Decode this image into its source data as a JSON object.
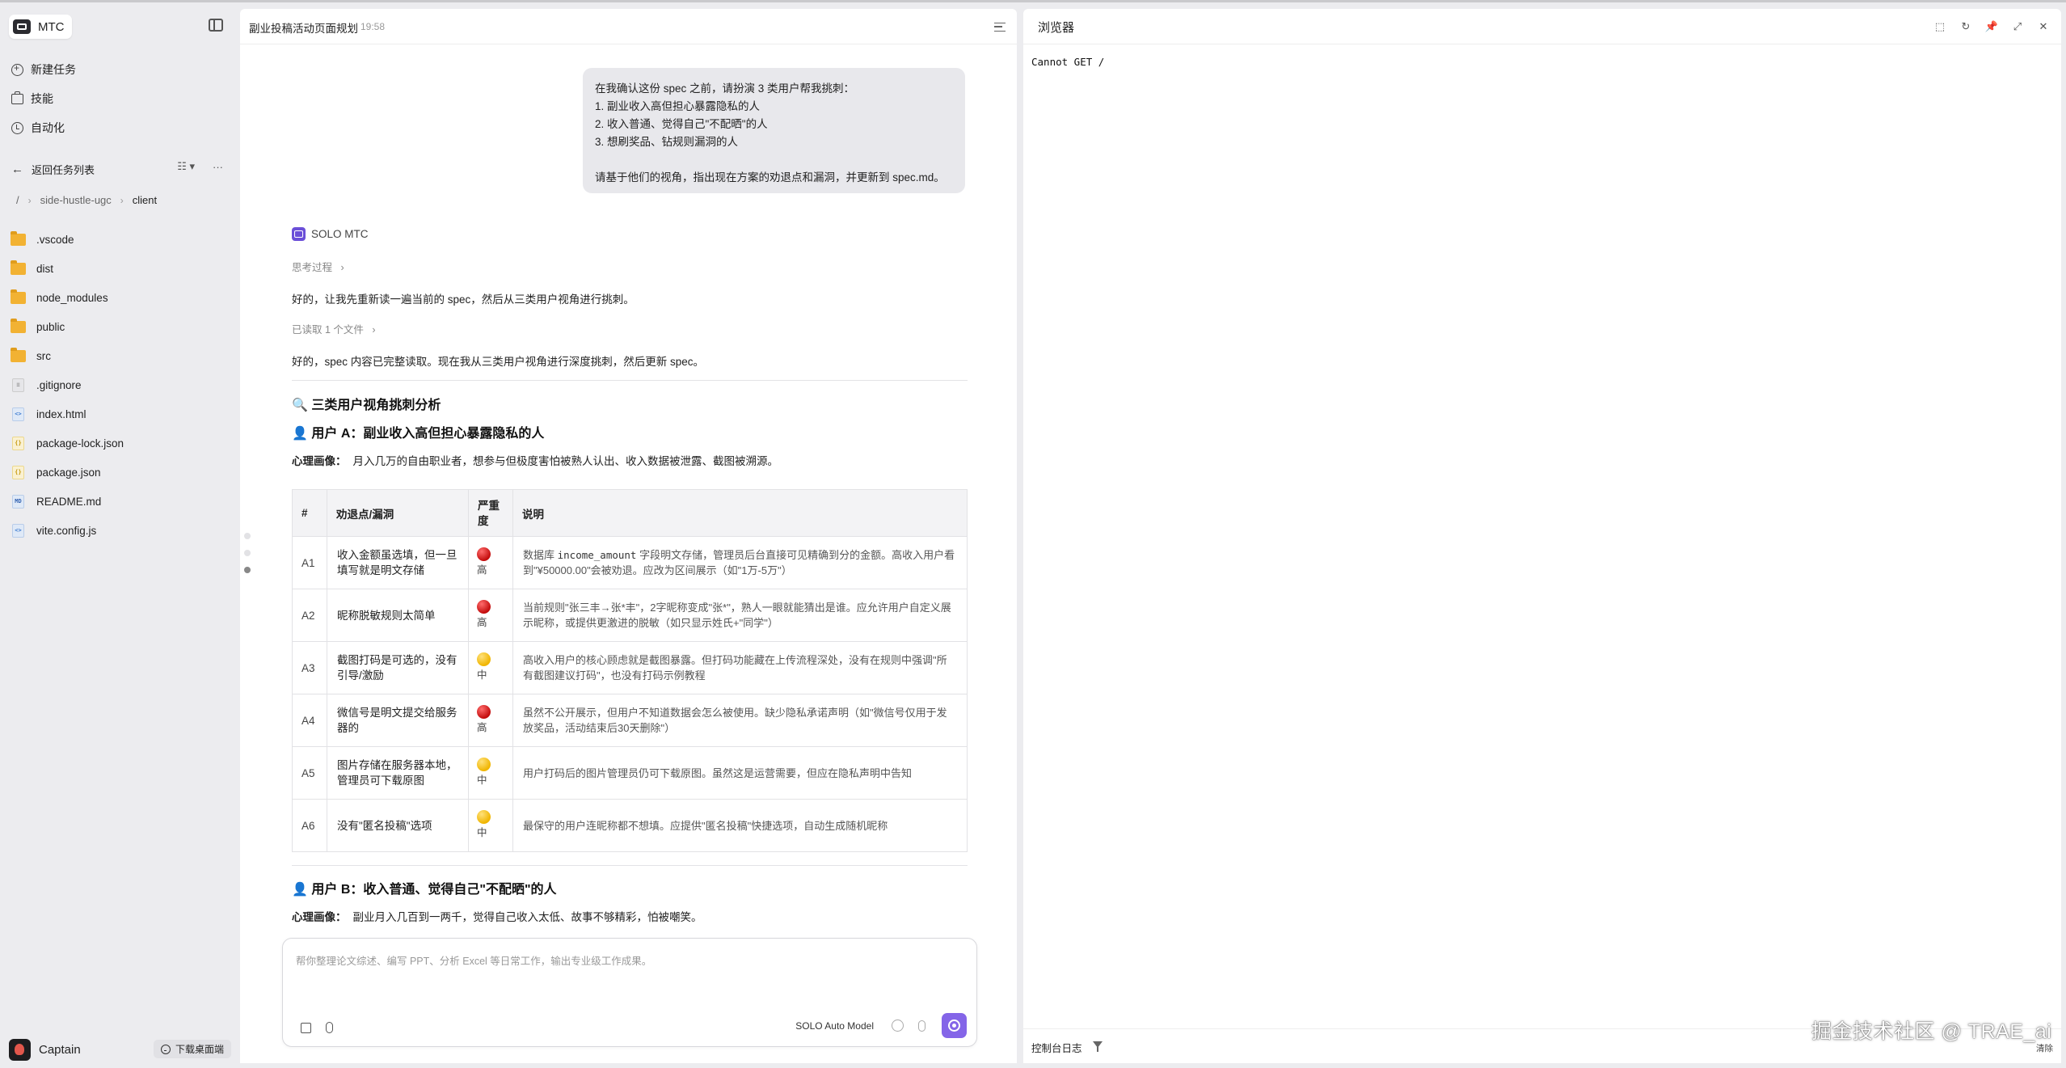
{
  "sidebar": {
    "brand": "MTC",
    "nav": [
      {
        "label": "新建任务",
        "icon": "new-task-icon"
      },
      {
        "label": "技能",
        "icon": "skills-icon"
      },
      {
        "label": "自动化",
        "icon": "automation-icon"
      }
    ],
    "back_label": "返回任务列表",
    "breadcrumb": [
      "/",
      "side-hustle-ugc",
      "client"
    ],
    "files": [
      {
        "name": ".vscode",
        "type": "folder"
      },
      {
        "name": "dist",
        "type": "folder"
      },
      {
        "name": "node_modules",
        "type": "folder"
      },
      {
        "name": "public",
        "type": "folder"
      },
      {
        "name": "src",
        "type": "folder"
      },
      {
        "name": ".gitignore",
        "type": "git"
      },
      {
        "name": "index.html",
        "type": "html"
      },
      {
        "name": "package-lock.json",
        "type": "json"
      },
      {
        "name": "package.json",
        "type": "json"
      },
      {
        "name": "README.md",
        "type": "md"
      },
      {
        "name": "vite.config.js",
        "type": "js"
      }
    ],
    "user_name": "Captain",
    "download_label": "下载桌面端"
  },
  "chat": {
    "title": "副业投稿活动页面规划",
    "time": "19:58",
    "user_message": [
      "在我确认这份 spec 之前，请扮演 3 类用户帮我挑刺：",
      "1. 副业收入高但担心暴露隐私的人",
      "2. 收入普通、觉得自己\"不配晒\"的人",
      "3. 想刷奖品、钻规则漏洞的人",
      "",
      "请基于他们的视角，指出现在方案的劝退点和漏洞，并更新到 spec.md。"
    ],
    "agent_name": "SOLO MTC",
    "thinking_label": "思考过程",
    "reply_1": "好的，让我先重新读一遍当前的 spec，然后从三类用户视角进行挑刺。",
    "files_read_label": "已读取 1 个文件",
    "reply_2": "好的，spec 内容已完整读取。现在我从三类用户视角进行深度挑刺，然后更新 spec。",
    "section_title": "🔍 三类用户视角挑刺分析",
    "user_a_title": "👤 用户 A：副业收入高但担心暴露隐私的人",
    "user_a_profile_label": "心理画像：",
    "user_a_profile": "月入几万的自由职业者，想参与但极度害怕被熟人认出、收入数据被泄露、截图被溯源。",
    "table": {
      "headers": [
        "#",
        "劝退点/漏洞",
        "严重度",
        "说明"
      ],
      "rows": [
        {
          "id": "A1",
          "point": "收入金额虽选填，但一旦填写就是明文存储",
          "severity": "高",
          "level": "red",
          "desc_pre": "数据库 ",
          "desc_code": "income_amount",
          "desc_post": " 字段明文存储，管理员后台直接可见精确到分的金额。高收入用户看到\"¥50000.00\"会被劝退。应改为区间展示（如\"1万-5万\"）"
        },
        {
          "id": "A2",
          "point": "昵称脱敏规则太简单",
          "severity": "高",
          "level": "red",
          "desc_pre": "当前规则\"张三丰→张*丰\"，2字昵称变成\"张*\"，熟人一眼就能猜出是谁。应允许用户自定义展示昵称，或提供更激进的脱敏（如只显示姓氏+\"同学\"）",
          "desc_code": "",
          "desc_post": ""
        },
        {
          "id": "A3",
          "point": "截图打码是可选的，没有引导/激励",
          "severity": "中",
          "level": "yellow",
          "desc_pre": "高收入用户的核心顾虑就是截图暴露。但打码功能藏在上传流程深处，没有在规则中强调\"所有截图建议打码\"，也没有打码示例教程",
          "desc_code": "",
          "desc_post": ""
        },
        {
          "id": "A4",
          "point": "微信号是明文提交给服务器的",
          "severity": "高",
          "level": "red",
          "desc_pre": "虽然不公开展示，但用户不知道数据会怎么被使用。缺少隐私承诺声明（如\"微信号仅用于发放奖品，活动结束后30天删除\"）",
          "desc_code": "",
          "desc_post": ""
        },
        {
          "id": "A5",
          "point": "图片存储在服务器本地，管理员可下载原图",
          "severity": "中",
          "level": "yellow",
          "desc_pre": "用户打码后的图片管理员仍可下载原图。虽然这是运营需要，但应在隐私声明中告知",
          "desc_code": "",
          "desc_post": ""
        },
        {
          "id": "A6",
          "point": "没有\"匿名投稿\"选项",
          "severity": "中",
          "level": "yellow",
          "desc_pre": "最保守的用户连昵称都不想填。应提供\"匿名投稿\"快捷选项，自动生成随机昵称",
          "desc_code": "",
          "desc_post": ""
        }
      ]
    },
    "user_b_title": "👤 用户 B：收入普通、觉得自己\"不配晒\"的人",
    "user_b_profile_label": "心理画像：",
    "user_b_profile": "副业月入几百到一两千，觉得自己收入太低、故事不够精彩，怕被嘲笑。",
    "composer_placeholder": "帮你整理论文综述、编写 PPT、分析 Excel 等日常工作，输出专业级工作成果。",
    "model_label": "SOLO Auto Model"
  },
  "browser": {
    "title": "浏览器",
    "content": "Cannot GET /",
    "console_label": "控制台日志",
    "clear_label": "清除"
  },
  "watermark": "掘金技术社区 @ TRAE_ai",
  "colors": {
    "accent": "#8465e8",
    "folder": "#f2b233",
    "severity_high": "#d11a1a",
    "severity_mid": "#f5c000"
  }
}
